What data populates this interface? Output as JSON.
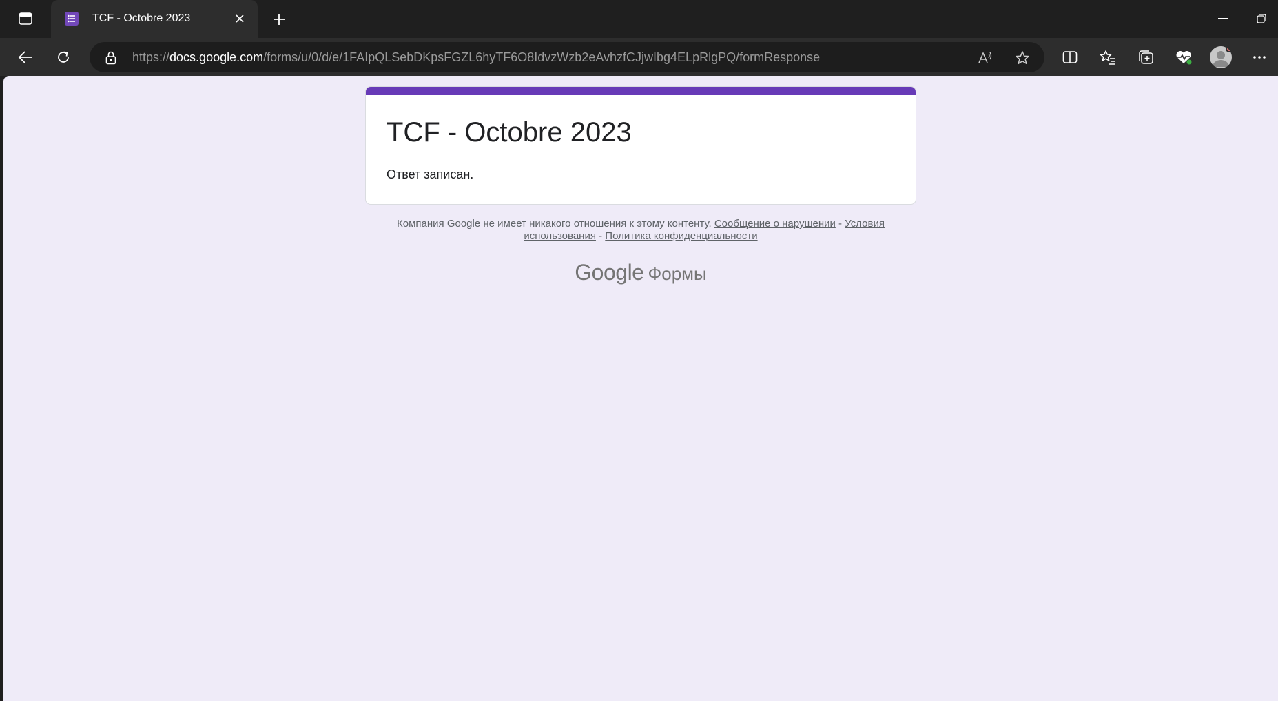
{
  "browser": {
    "tab": {
      "title": "TCF - Octobre 2023"
    },
    "address": {
      "scheme": "https://",
      "host": "docs.google.com",
      "path": "/forms/u/0/d/e/1FAIpQLSebDKpsFGZL6hyTF6O8IdvzWzb2eAvhzfCJjwIbg4ELpRlgPQ/formResponse"
    },
    "colors": {
      "tab_bg": "#2d2d2d",
      "frame_bg": "#1f1f1f",
      "favicon": "#7248b9",
      "avatar_badge": "#e8716f"
    }
  },
  "form": {
    "title": "TCF - Octobre 2023",
    "message": "Ответ записан.",
    "accent_color": "#673ab7",
    "page_bg": "#efebf8"
  },
  "footer": {
    "disclaimer_text": "Компания Google не имеет никакого отношения к этому контенту.",
    "report_link": "Сообщение о нарушении",
    "terms_link": "Условия использования",
    "privacy_link": "Политика конфиденциальности",
    "separator": "-",
    "brand_google": "Google",
    "brand_product": "Формы"
  }
}
